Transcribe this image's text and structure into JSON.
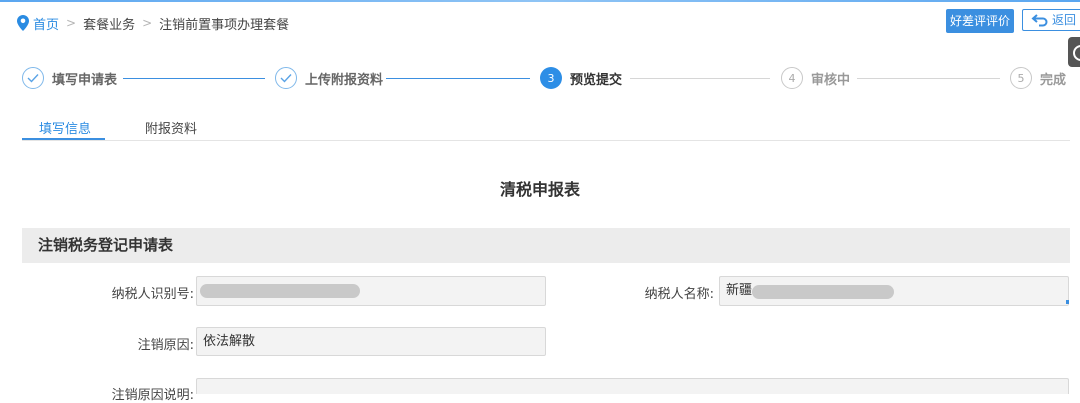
{
  "breadcrumb": {
    "home": "首页",
    "separator": ">",
    "level1": "套餐业务",
    "level2": "注销前置事项办理套餐"
  },
  "header_buttons": {
    "evaluate": "好差评评价",
    "back": "返回"
  },
  "steps": [
    {
      "num": "1",
      "label": "填写申请表",
      "status": "done"
    },
    {
      "num": "2",
      "label": "上传附报资料",
      "status": "done"
    },
    {
      "num": "3",
      "label": "预览提交",
      "status": "active"
    },
    {
      "num": "4",
      "label": "审核中",
      "status": "pending"
    },
    {
      "num": "5",
      "label": "完成",
      "status": "pending"
    }
  ],
  "tabs": [
    {
      "label": "填写信息",
      "active": true
    },
    {
      "label": "附报资料",
      "active": false
    }
  ],
  "form_title": "清税申报表",
  "section_title": "注销税务登记申请表",
  "fields": {
    "taxpayer_id": {
      "label": "纳税人识别号:",
      "value": ""
    },
    "taxpayer_name": {
      "label": "纳税人名称:",
      "value": "新疆"
    },
    "reason": {
      "label": "注销原因:",
      "value": "依法解散"
    },
    "reason_note": {
      "label": "注销原因说明:",
      "value": ""
    }
  },
  "colors": {
    "accent": "#3b8fe0",
    "section_bg": "#ececec",
    "field_bg": "#f3f3f3"
  }
}
